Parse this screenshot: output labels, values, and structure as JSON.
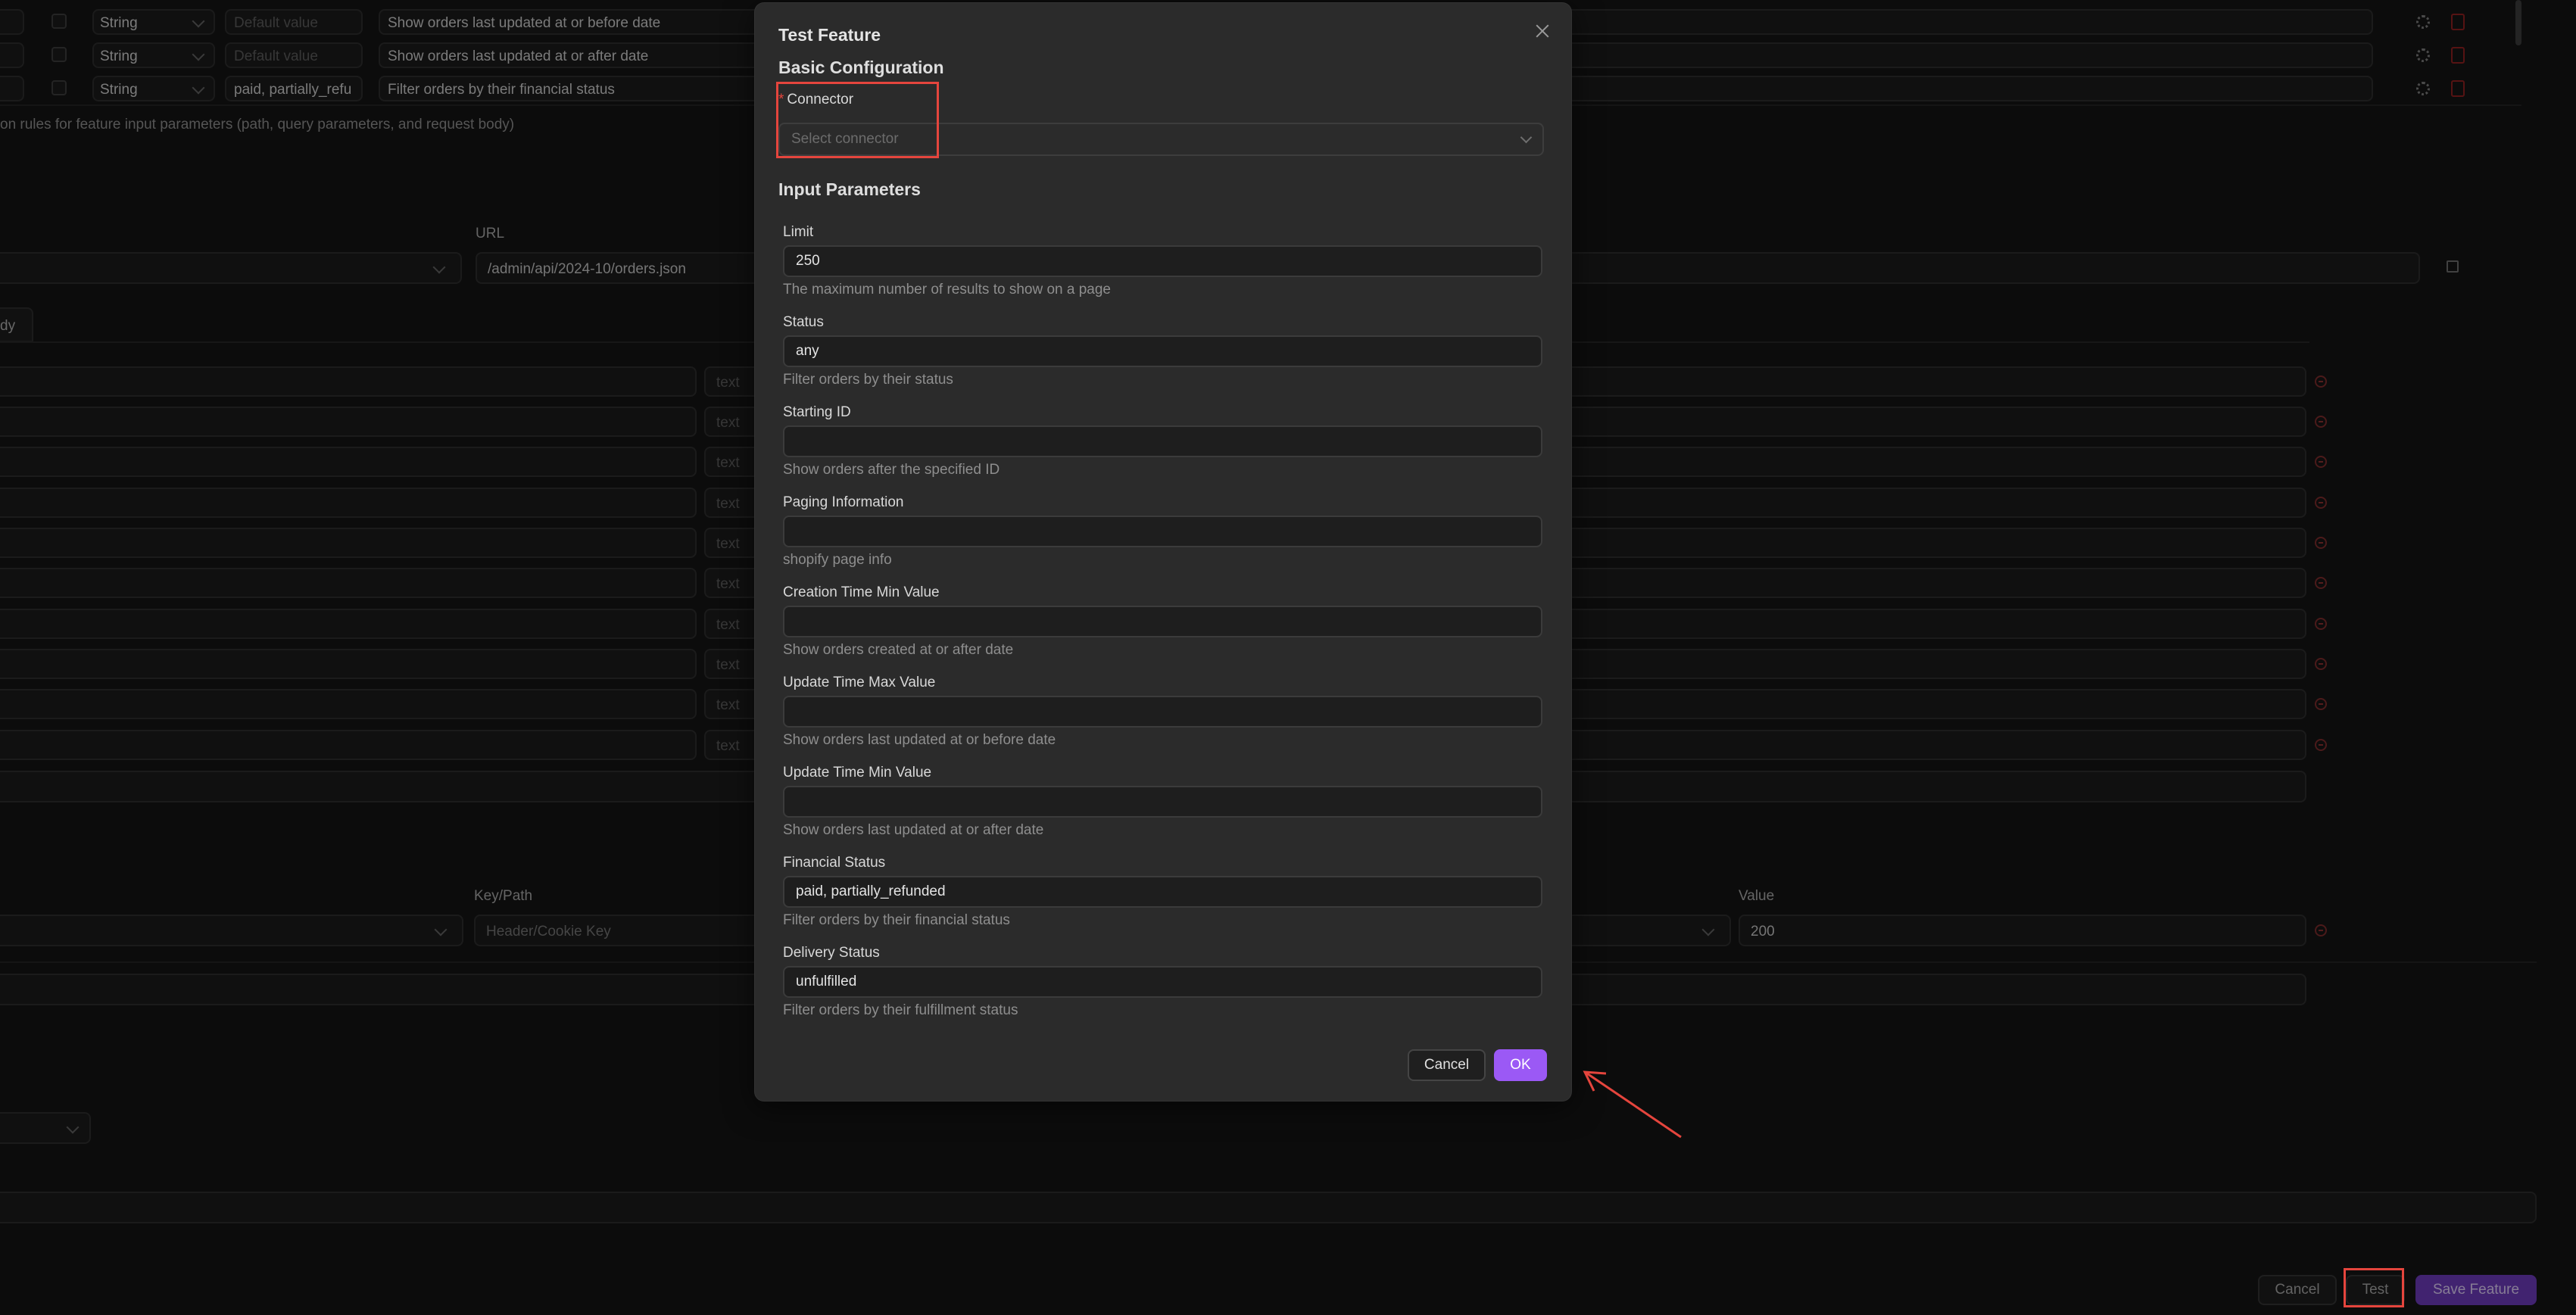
{
  "background": {
    "param_rows": [
      {
        "type": "String",
        "default_placeholder": "Default value",
        "description": "Show orders last updated at or before date"
      },
      {
        "type": "String",
        "default_placeholder": "Default value",
        "description": "Show orders last updated at or after date"
      },
      {
        "type": "String",
        "default_value": "paid, partially_refu",
        "description": "Filter orders by their financial status"
      }
    ],
    "validation_hint": "on rules for feature input parameters (path, query parameters, and request body)",
    "url_label": "URL",
    "url_value": "/admin/api/2024-10/orders.json",
    "tab_fragment": "dy",
    "text_placeholder": "text",
    "keypath_label": "Key/Path",
    "keypath_placeholder": "Header/Cookie Key",
    "value_label": "Value",
    "value_value": "200",
    "footer": {
      "cancel": "Cancel",
      "test": "Test",
      "save": "Save Feature"
    }
  },
  "modal": {
    "title": "Test Feature",
    "basic_section": "Basic Configuration",
    "connector": {
      "required_mark": "*",
      "label": "Connector",
      "placeholder": "Select connector"
    },
    "input_section": "Input Parameters",
    "fields": [
      {
        "label": "Limit",
        "value": "250",
        "help": "The maximum number of results to show on a page"
      },
      {
        "label": "Status",
        "value": "any",
        "help": "Filter orders by their status"
      },
      {
        "label": "Starting ID",
        "value": "",
        "help": "Show orders after the specified ID"
      },
      {
        "label": "Paging Information",
        "value": "",
        "help": "shopify page info"
      },
      {
        "label": "Creation Time Min Value",
        "value": "",
        "help": "Show orders created at or after date"
      },
      {
        "label": "Update Time Max Value",
        "value": "",
        "help": "Show orders last updated at or before date"
      },
      {
        "label": "Update Time Min Value",
        "value": "",
        "help": "Show orders last updated at or after date"
      },
      {
        "label": "Financial Status",
        "value": "paid, partially_refunded",
        "help": "Filter orders by their financial status"
      },
      {
        "label": "Delivery Status",
        "value": "unfulfilled",
        "help": "Filter orders by their fulfillment status"
      }
    ],
    "cancel_label": "Cancel",
    "ok_label": "OK"
  },
  "colors": {
    "accent": "#9b59f5",
    "highlight": "#e5453d",
    "modal_bg": "#2b2b2b"
  }
}
